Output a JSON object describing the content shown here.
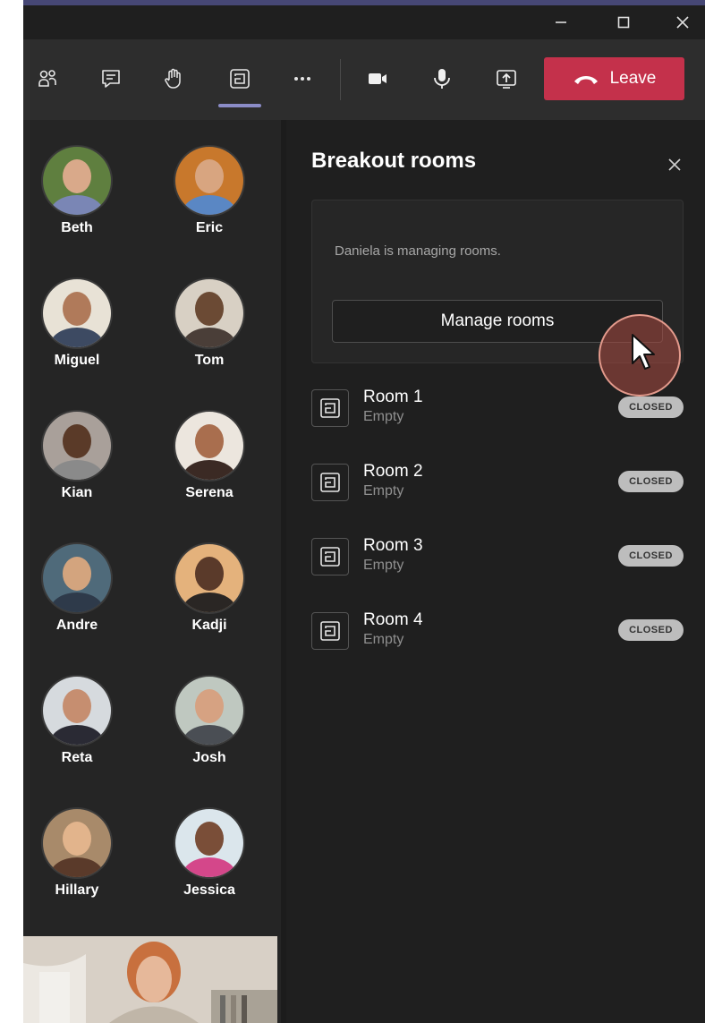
{
  "window": {
    "minimize_icon": "minimize-icon",
    "maximize_icon": "maximize-icon",
    "close_icon": "close-icon"
  },
  "toolbar": {
    "icons": [
      "people-icon",
      "chat-icon",
      "raise-hand-icon",
      "breakout-rooms-icon",
      "more-icon",
      "camera-icon",
      "microphone-icon",
      "share-screen-icon"
    ],
    "leave_label": "Leave",
    "leave_color": "#c4314b",
    "accent_color": "#8b8cc7"
  },
  "gallery": {
    "participants": [
      {
        "name": "Beth"
      },
      {
        "name": "Eric"
      },
      {
        "name": "Miguel"
      },
      {
        "name": "Tom"
      },
      {
        "name": "Kian"
      },
      {
        "name": "Serena"
      },
      {
        "name": "Andre"
      },
      {
        "name": "Kadji"
      },
      {
        "name": "Reta"
      },
      {
        "name": "Josh"
      },
      {
        "name": "Hillary"
      },
      {
        "name": "Jessica"
      }
    ]
  },
  "panel": {
    "title": "Breakout rooms",
    "managing_text": "Daniela is managing rooms.",
    "manage_button": "Manage rooms",
    "rooms": [
      {
        "name": "Room 1",
        "status": "Empty",
        "badge": "CLOSED"
      },
      {
        "name": "Room 2",
        "status": "Empty",
        "badge": "CLOSED"
      },
      {
        "name": "Room 3",
        "status": "Empty",
        "badge": "CLOSED"
      },
      {
        "name": "Room 4",
        "status": "Empty",
        "badge": "CLOSED"
      }
    ]
  }
}
